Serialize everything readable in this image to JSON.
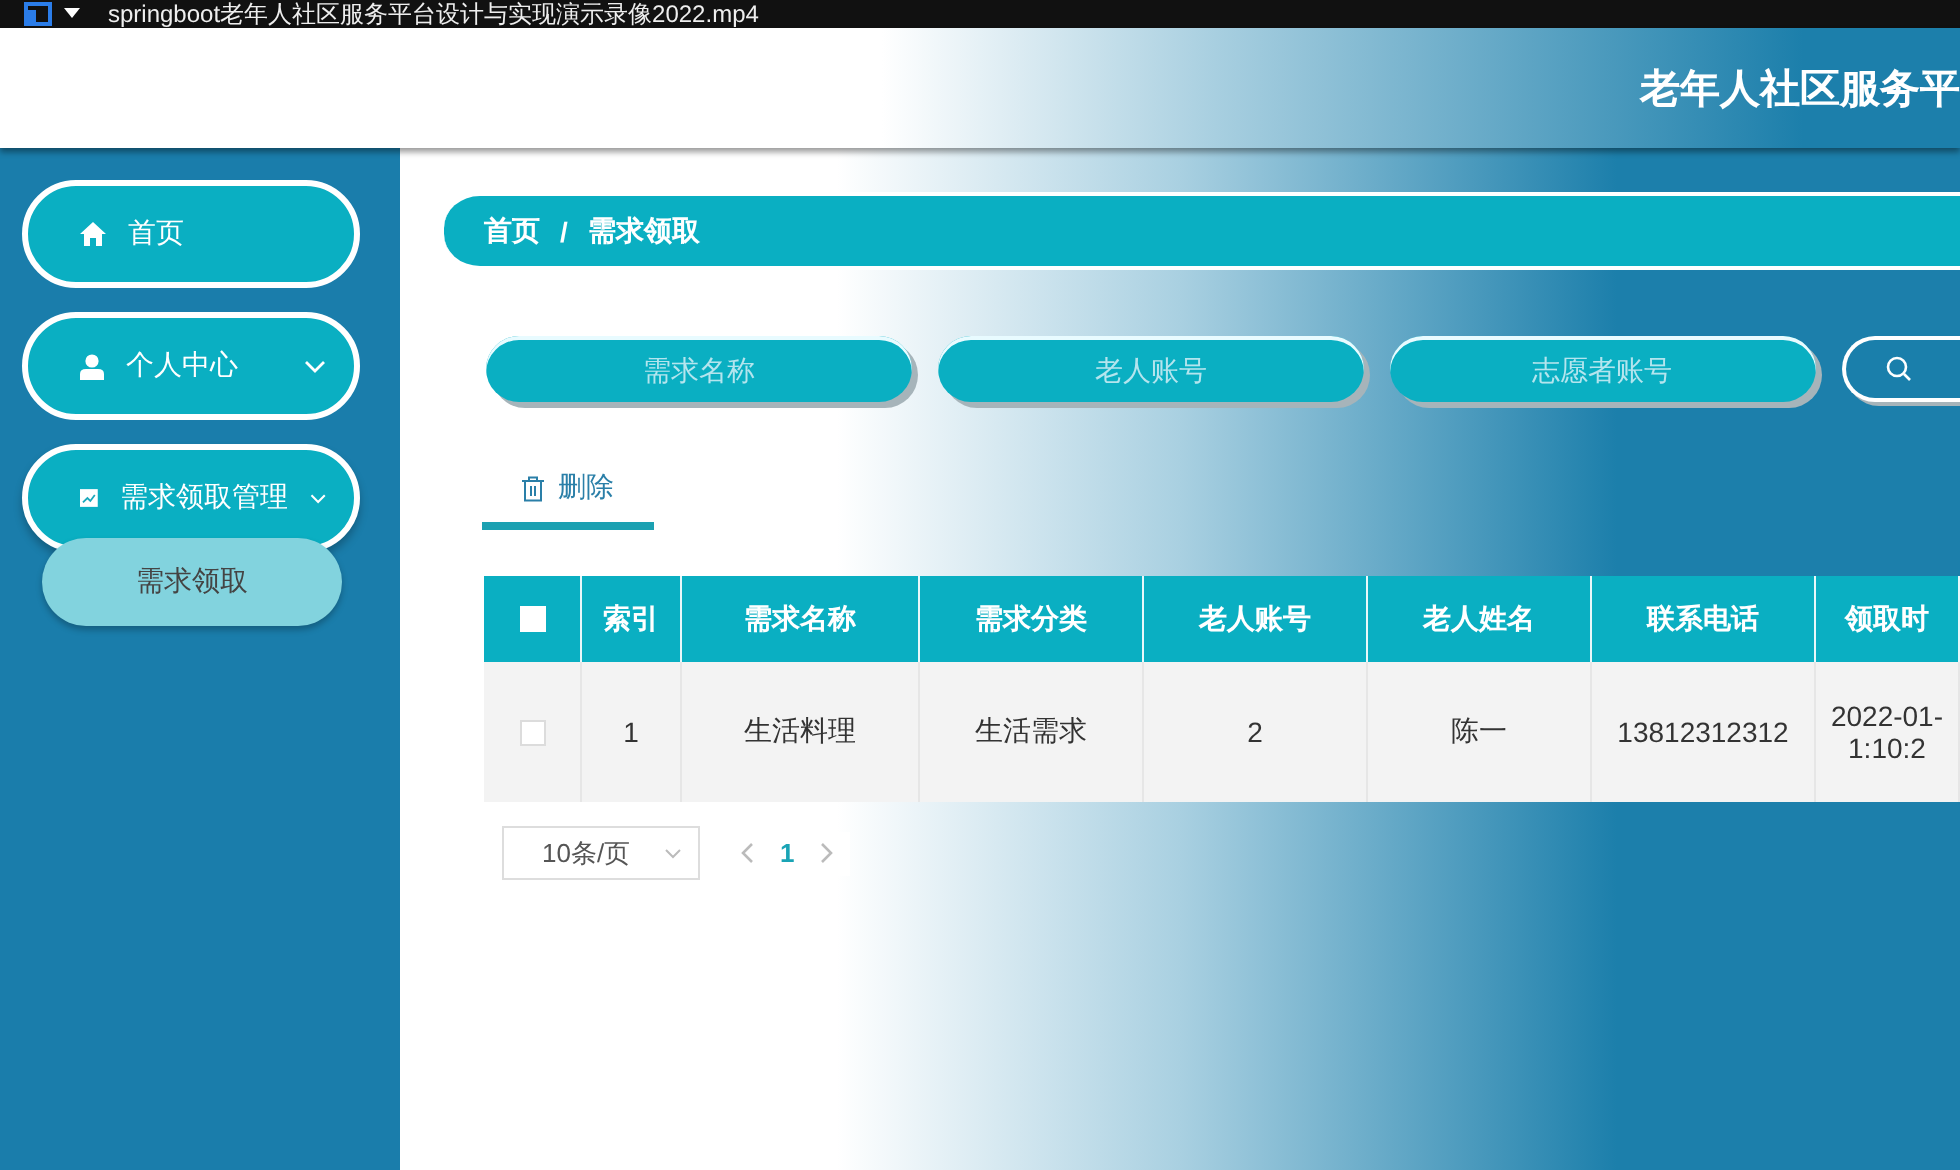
{
  "player": {
    "title": "springboot老年人社区服务平台设计与实现演示录像2022.mp4"
  },
  "header": {
    "title": "老年人社区服务平"
  },
  "sidebar": {
    "items": [
      {
        "kind": "link",
        "label": "首页"
      },
      {
        "kind": "group",
        "label": "个人中心"
      },
      {
        "kind": "group",
        "label": "需求领取管理",
        "expanded": true,
        "children": [
          {
            "label": "需求领取"
          }
        ]
      }
    ]
  },
  "breadcrumb": {
    "items": [
      "首页",
      "需求领取"
    ],
    "separator": "/"
  },
  "search": {
    "fields": [
      {
        "placeholder": "需求名称"
      },
      {
        "placeholder": "老人账号"
      },
      {
        "placeholder": "志愿者账号"
      }
    ]
  },
  "toolbar": {
    "delete_button": "删除"
  },
  "table": {
    "select_all_checked": false,
    "columns": [
      "索引",
      "需求名称",
      "需求分类",
      "老人账号",
      "老人姓名",
      "联系电话",
      "领取时"
    ],
    "rows": [
      {
        "checked": false,
        "cells": [
          "1",
          "生活料理",
          "生活需求",
          "2",
          "陈一",
          "13812312312",
          "2022-01-\n1:10:2"
        ]
      }
    ]
  },
  "pagination": {
    "page_size": "10条/页",
    "pages": [
      {
        "label": "1",
        "selected": true
      }
    ]
  }
}
